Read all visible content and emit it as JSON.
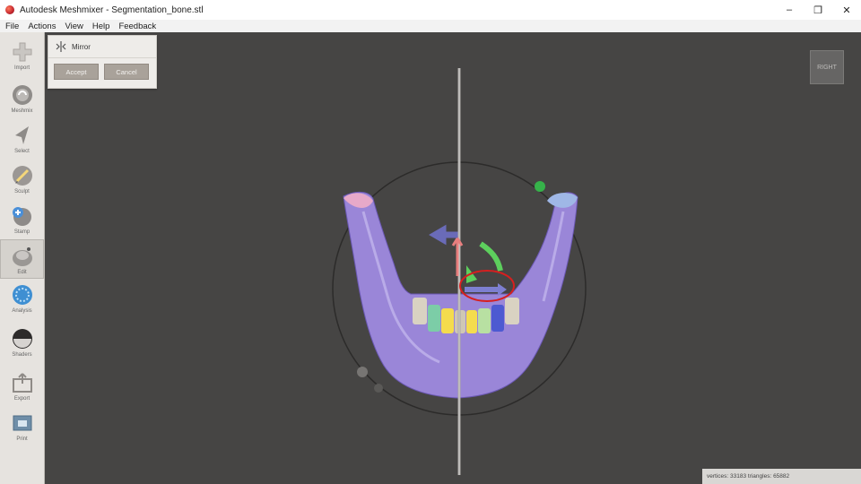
{
  "window": {
    "title": "Autodesk Meshmixer - Segmentation_bone.stl",
    "controls": [
      "–",
      "❐",
      "✕"
    ]
  },
  "menu": [
    "File",
    "Actions",
    "View",
    "Help",
    "Feedback"
  ],
  "toolbar": [
    {
      "label": "Import",
      "icon": "import-icon"
    },
    {
      "label": "Meshmix",
      "icon": "meshmix-icon"
    },
    {
      "label": "Select",
      "icon": "select-icon"
    },
    {
      "label": "Sculpt",
      "icon": "sculpt-icon"
    },
    {
      "label": "Stamp",
      "icon": "stamp-icon"
    },
    {
      "label": "Edit",
      "icon": "edit-icon",
      "active": true
    },
    {
      "label": "Analysis",
      "icon": "analysis-icon"
    },
    {
      "label": "Shaders",
      "icon": "shaders-icon"
    },
    {
      "label": "Export",
      "icon": "export-icon"
    },
    {
      "label": "Print",
      "icon": "print-icon"
    }
  ],
  "mirror_panel": {
    "title": "Mirror",
    "accept_label": "Accept",
    "cancel_label": "Cancel"
  },
  "viewcube": {
    "label": "RIGHT"
  },
  "status": {
    "text": "vertices: 33183 triangles: 65882"
  },
  "colors": {
    "viewport_bg": "#464544",
    "mesh": "#9a86d8",
    "gizmo_green": "#5dcf5d",
    "gizmo_red": "#e87e7e",
    "gizmo_blue": "#7d7fd0",
    "highlight_red": "#d61f1f"
  }
}
